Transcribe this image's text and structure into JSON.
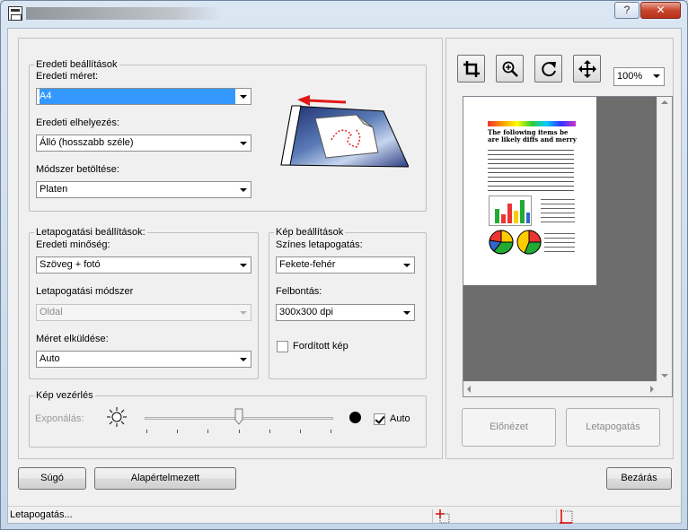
{
  "window": {
    "title": "",
    "help_label": "?",
    "close_label": "✕"
  },
  "original": {
    "legend": "Eredeti beállítások",
    "size_label": "Eredeti méret:",
    "size_value": "A4",
    "orientation_label": "Eredeti elhelyezés:",
    "orientation_value": "Álló (hosszabb széle)",
    "feed_label": "Módszer betöltése:",
    "feed_value": "Platen"
  },
  "scan": {
    "legend": "Letapogatási beállítások:",
    "quality_label": "Eredeti minőség:",
    "quality_value": "Szöveg + fotó",
    "method_label": "Letapogatási módszer",
    "method_value": "Oldal",
    "size_send_label": "Méret elküldése:",
    "size_send_value": "Auto"
  },
  "image": {
    "legend": "Kép beállítások",
    "color_label": "Színes letapogatás:",
    "color_value": "Fekete-fehér",
    "resolution_label": "Felbontás:",
    "resolution_value": "300x300 dpi",
    "invert_label": "Fordított kép",
    "invert_checked": false
  },
  "control": {
    "legend": "Kép vezérlés",
    "exposure_label": "Exponálás:",
    "exposure_level": 0.5,
    "auto_label": "Auto",
    "auto_checked": true
  },
  "preview": {
    "zoom_value": "100%",
    "tools": [
      "crop-icon",
      "zoom-in-icon",
      "rotate-icon",
      "move-icon"
    ],
    "preview_button": "Előnézet",
    "scan_button": "Letapogatás",
    "doc_heading": "The following items be are likely diffs and merry"
  },
  "buttons": {
    "help": "Súgó",
    "defaults": "Alapértelmezett",
    "close": "Bezárás"
  },
  "status": {
    "text": "Letapogatás..."
  },
  "colors": {
    "selection": "#3399ff",
    "preview_bg": "#6d6d6d"
  }
}
